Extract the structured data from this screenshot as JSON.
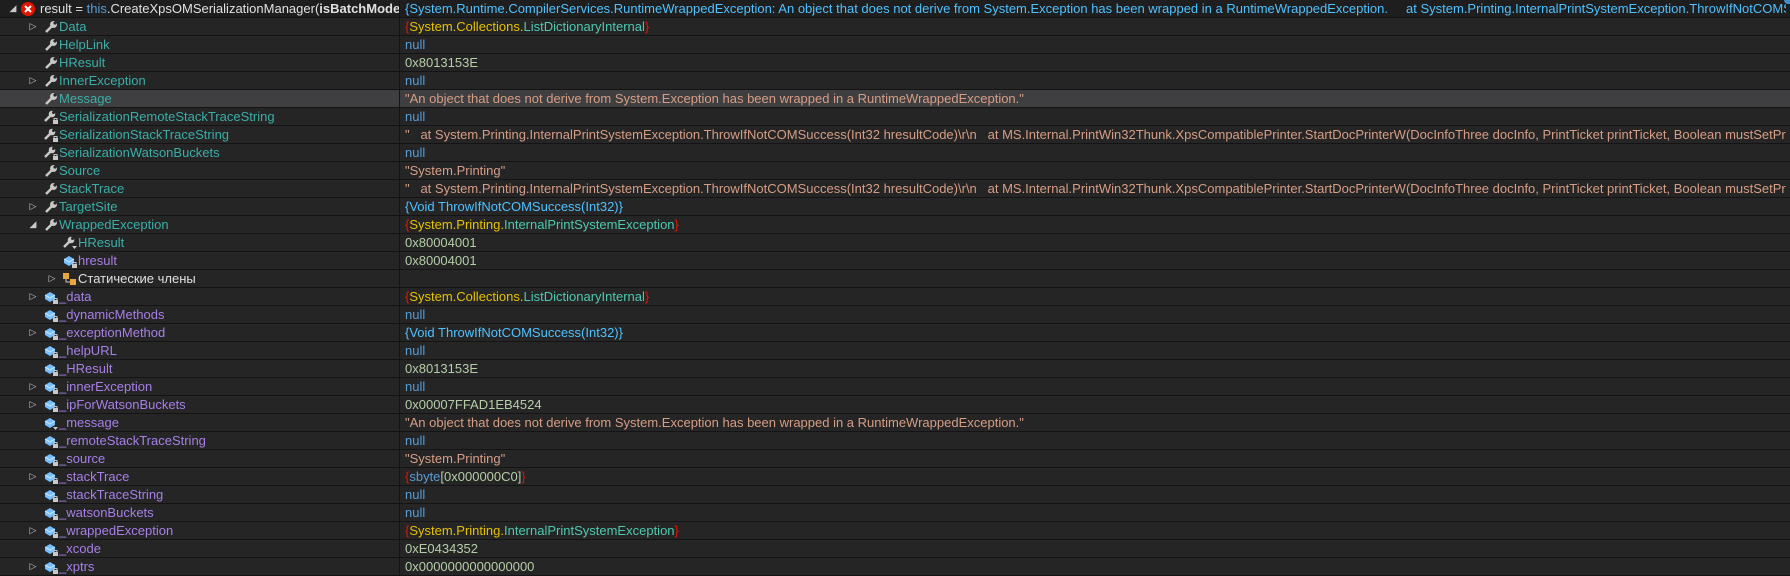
{
  "colors": {
    "property": "#3aaea6",
    "field": "#a77fe6",
    "null": "#569cd6",
    "number": "#b5cea8",
    "string": "#d69d85",
    "brace": "#e51400",
    "namespace": "#e5c100",
    "class": "#4ec9b0",
    "selected_row": "#3f3f41"
  },
  "rows": [
    {
      "kind": "root",
      "icon": "error-icon",
      "depth": 0,
      "expander": "expanded",
      "name_parts": [
        {
          "t": "plain",
          "text": "result = "
        },
        {
          "t": "kw",
          "text": "this"
        },
        {
          "t": "plain",
          "text": ".CreateXpsOMSerializationManager("
        },
        {
          "t": "bold",
          "text": "isBatchMode"
        },
        {
          "t": "plain",
          "text": ", fal..."
        }
      ],
      "value_parts": [
        {
          "t": "err",
          "text": "{System.Runtime.CompilerServices.RuntimeWrappedException: An object that does not derive from System.Exception has been wrapped in a RuntimeWrappedException.     at System.Printing.InternalPrintSystemException.ThrowIfNotCOMSuccess(Int32 hresultCo..."
        }
      ]
    },
    {
      "kind": "prop",
      "icon": "wrench-icon",
      "depth": 1,
      "expander": "collapsed",
      "name": "Data",
      "value_parts": [
        {
          "t": "brace",
          "text": "{"
        },
        {
          "t": "ns",
          "text": "System.Collections."
        },
        {
          "t": "class",
          "text": "ListDictionaryInternal"
        },
        {
          "t": "brace",
          "text": "}"
        }
      ]
    },
    {
      "kind": "prop",
      "icon": "wrench-icon",
      "depth": 1,
      "expander": "none",
      "name": "HelpLink",
      "value_parts": [
        {
          "t": "null",
          "text": "null"
        }
      ]
    },
    {
      "kind": "prop",
      "icon": "wrench-icon",
      "depth": 1,
      "expander": "none",
      "name": "HResult",
      "value_parts": [
        {
          "t": "num",
          "text": "0x8013153E"
        }
      ]
    },
    {
      "kind": "prop",
      "icon": "wrench-icon",
      "depth": 1,
      "expander": "collapsed",
      "name": "InnerException",
      "value_parts": [
        {
          "t": "null",
          "text": "null"
        }
      ]
    },
    {
      "kind": "prop",
      "icon": "wrench-icon",
      "depth": 1,
      "expander": "none",
      "name": "Message",
      "selected": true,
      "value_parts": [
        {
          "t": "str",
          "text": "\"An object that does not derive from System.Exception has been wrapped in a RuntimeWrappedException.\""
        }
      ]
    },
    {
      "kind": "prop",
      "icon": "wrench-lock-icon",
      "depth": 1,
      "expander": "none",
      "name": "SerializationRemoteStackTraceString",
      "value_parts": [
        {
          "t": "null",
          "text": "null"
        }
      ]
    },
    {
      "kind": "prop",
      "icon": "wrench-lock-icon",
      "depth": 1,
      "expander": "none",
      "name": "SerializationStackTraceString",
      "value_parts": [
        {
          "t": "str",
          "text": "\"   at System.Printing.InternalPrintSystemException.ThrowIfNotCOMSuccess(Int32 hresultCode)\\r\\n   at MS.Internal.PrintWin32Thunk.XpsCompatiblePrinter.StartDocPrinterW(DocInfoThree docInfo, PrintTicket printTicket, Boolean mustSetPrintJobIdentifier)\\r\\n..."
        }
      ]
    },
    {
      "kind": "prop",
      "icon": "wrench-lock-icon",
      "depth": 1,
      "expander": "none",
      "name": "SerializationWatsonBuckets",
      "value_parts": [
        {
          "t": "null",
          "text": "null"
        }
      ]
    },
    {
      "kind": "prop",
      "icon": "wrench-icon",
      "depth": 1,
      "expander": "none",
      "name": "Source",
      "value_parts": [
        {
          "t": "str",
          "text": "\"System.Printing\""
        }
      ]
    },
    {
      "kind": "prop",
      "icon": "wrench-icon",
      "depth": 1,
      "expander": "none",
      "name": "StackTrace",
      "value_parts": [
        {
          "t": "str",
          "text": "\"   at System.Printing.InternalPrintSystemException.ThrowIfNotCOMSuccess(Int32 hresultCode)\\r\\n   at MS.Internal.PrintWin32Thunk.XpsCompatiblePrinter.StartDocPrinterW(DocInfoThree docInfo, PrintTicket printTicket, Boolean mustSetPrintJobIdentifier)\\r\\n..."
        }
      ]
    },
    {
      "kind": "prop",
      "icon": "wrench-icon",
      "depth": 1,
      "expander": "collapsed",
      "name": "TargetSite",
      "value_parts": [
        {
          "t": "method",
          "text": "{Void ThrowIfNotCOMSuccess(Int32)}"
        }
      ]
    },
    {
      "kind": "prop",
      "icon": "wrench-icon",
      "depth": 1,
      "expander": "expanded",
      "name": "WrappedException",
      "value_parts": [
        {
          "t": "brace",
          "text": "{"
        },
        {
          "t": "ns",
          "text": "System.Printing."
        },
        {
          "t": "class",
          "text": "InternalPrintSystemException"
        },
        {
          "t": "brace",
          "text": "}"
        }
      ]
    },
    {
      "kind": "prop",
      "icon": "wrench-virtual-icon",
      "depth": 2,
      "expander": "none",
      "name": "HResult",
      "value_parts": [
        {
          "t": "num",
          "text": "0x80004001"
        }
      ]
    },
    {
      "kind": "field",
      "icon": "field-lock-icon",
      "depth": 2,
      "expander": "none",
      "name": "hresult",
      "value_parts": [
        {
          "t": "num",
          "text": "0x80004001"
        }
      ]
    },
    {
      "kind": "static",
      "icon": "static-members-icon",
      "depth": 2,
      "expander": "collapsed",
      "name": "Статические члены",
      "value_parts": []
    },
    {
      "kind": "field",
      "icon": "field-lock-icon",
      "depth": 1,
      "expander": "collapsed",
      "name": "_data",
      "value_parts": [
        {
          "t": "brace",
          "text": "{"
        },
        {
          "t": "ns",
          "text": "System.Collections."
        },
        {
          "t": "class",
          "text": "ListDictionaryInternal"
        },
        {
          "t": "brace",
          "text": "}"
        }
      ]
    },
    {
      "kind": "field",
      "icon": "field-lock-icon",
      "depth": 1,
      "expander": "none",
      "name": "_dynamicMethods",
      "value_parts": [
        {
          "t": "null",
          "text": "null"
        }
      ]
    },
    {
      "kind": "field",
      "icon": "field-lock-icon",
      "depth": 1,
      "expander": "collapsed",
      "name": "_exceptionMethod",
      "value_parts": [
        {
          "t": "method",
          "text": "{Void ThrowIfNotCOMSuccess(Int32)}"
        }
      ]
    },
    {
      "kind": "field",
      "icon": "field-lock-icon",
      "depth": 1,
      "expander": "none",
      "name": "_helpURL",
      "value_parts": [
        {
          "t": "null",
          "text": "null"
        }
      ]
    },
    {
      "kind": "field",
      "icon": "field-lock-icon",
      "depth": 1,
      "expander": "none",
      "name": "_HResult",
      "value_parts": [
        {
          "t": "num",
          "text": "0x8013153E"
        }
      ]
    },
    {
      "kind": "field",
      "icon": "field-lock-icon",
      "depth": 1,
      "expander": "collapsed",
      "name": "_innerException",
      "value_parts": [
        {
          "t": "null",
          "text": "null"
        }
      ]
    },
    {
      "kind": "field",
      "icon": "field-lock-icon",
      "depth": 1,
      "expander": "collapsed",
      "name": "_ipForWatsonBuckets",
      "value_parts": [
        {
          "t": "num",
          "text": "0x00007FFAD1EB4524"
        }
      ]
    },
    {
      "kind": "field",
      "icon": "field-internal-icon",
      "depth": 1,
      "expander": "none",
      "name": "_message",
      "value_parts": [
        {
          "t": "str",
          "text": "\"An object that does not derive from System.Exception has been wrapped in a RuntimeWrappedException.\""
        }
      ]
    },
    {
      "kind": "field",
      "icon": "field-lock-icon",
      "depth": 1,
      "expander": "none",
      "name": "_remoteStackTraceString",
      "value_parts": [
        {
          "t": "null",
          "text": "null"
        }
      ]
    },
    {
      "kind": "field",
      "icon": "field-lock-icon",
      "depth": 1,
      "expander": "none",
      "name": "_source",
      "value_parts": [
        {
          "t": "str",
          "text": "\"System.Printing\""
        }
      ]
    },
    {
      "kind": "field",
      "icon": "field-lock-icon",
      "depth": 1,
      "expander": "collapsed",
      "name": "_stackTrace",
      "value_parts": [
        {
          "t": "brace",
          "text": "{"
        },
        {
          "t": "null",
          "text": "sbyte"
        },
        {
          "t": "num",
          "text": "[0x000000C0]"
        },
        {
          "t": "brace",
          "text": "}"
        }
      ]
    },
    {
      "kind": "field",
      "icon": "field-lock-icon",
      "depth": 1,
      "expander": "none",
      "name": "_stackTraceString",
      "value_parts": [
        {
          "t": "null",
          "text": "null"
        }
      ]
    },
    {
      "kind": "field",
      "icon": "field-lock-icon",
      "depth": 1,
      "expander": "none",
      "name": "_watsonBuckets",
      "value_parts": [
        {
          "t": "null",
          "text": "null"
        }
      ]
    },
    {
      "kind": "field",
      "icon": "field-lock-icon",
      "depth": 1,
      "expander": "collapsed",
      "name": "_wrappedException",
      "value_parts": [
        {
          "t": "brace",
          "text": "{"
        },
        {
          "t": "ns",
          "text": "System.Printing."
        },
        {
          "t": "class",
          "text": "InternalPrintSystemException"
        },
        {
          "t": "brace",
          "text": "}"
        }
      ]
    },
    {
      "kind": "field",
      "icon": "field-lock-icon",
      "depth": 1,
      "expander": "none",
      "name": "_xcode",
      "value_parts": [
        {
          "t": "num",
          "text": "0xE0434352"
        }
      ]
    },
    {
      "kind": "field",
      "icon": "field-lock-icon",
      "depth": 1,
      "expander": "collapsed",
      "name": "_xptrs",
      "value_parts": [
        {
          "t": "num",
          "text": "0x0000000000000000"
        }
      ]
    }
  ]
}
